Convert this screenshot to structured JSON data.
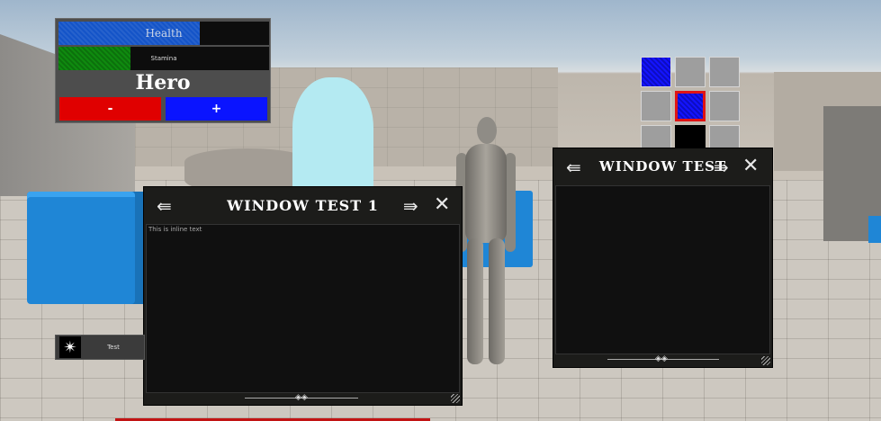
{
  "hud": {
    "health_label": "Health",
    "health_fraction": 0.67,
    "health_color": "#1454c8",
    "stamina_label": "Stamina",
    "stamina_fraction": 0.34,
    "stamina_color": "#0f8a0f",
    "name": "Hero",
    "minus_label": "-",
    "plus_label": "+",
    "minus_color": "#e00000",
    "plus_color": "#0a14ff"
  },
  "inventory": {
    "slots": [
      "blue",
      "gray",
      "gray",
      "gray",
      "blue-selected",
      "gray",
      "gray",
      "black",
      "gray"
    ]
  },
  "window1": {
    "title": "WINDOW TEST 1",
    "content_text": "This is inline text",
    "prev_icon": "prev-arrow-icon",
    "next_icon": "next-arrow-icon",
    "close_icon": "close-icon"
  },
  "window2": {
    "title": "WINDOW TEST",
    "prev_icon": "prev-arrow-icon",
    "next_icon": "next-arrow-icon",
    "close_icon": "close-icon"
  },
  "test_widget": {
    "label": "Test",
    "icon": "starburst-icon"
  }
}
